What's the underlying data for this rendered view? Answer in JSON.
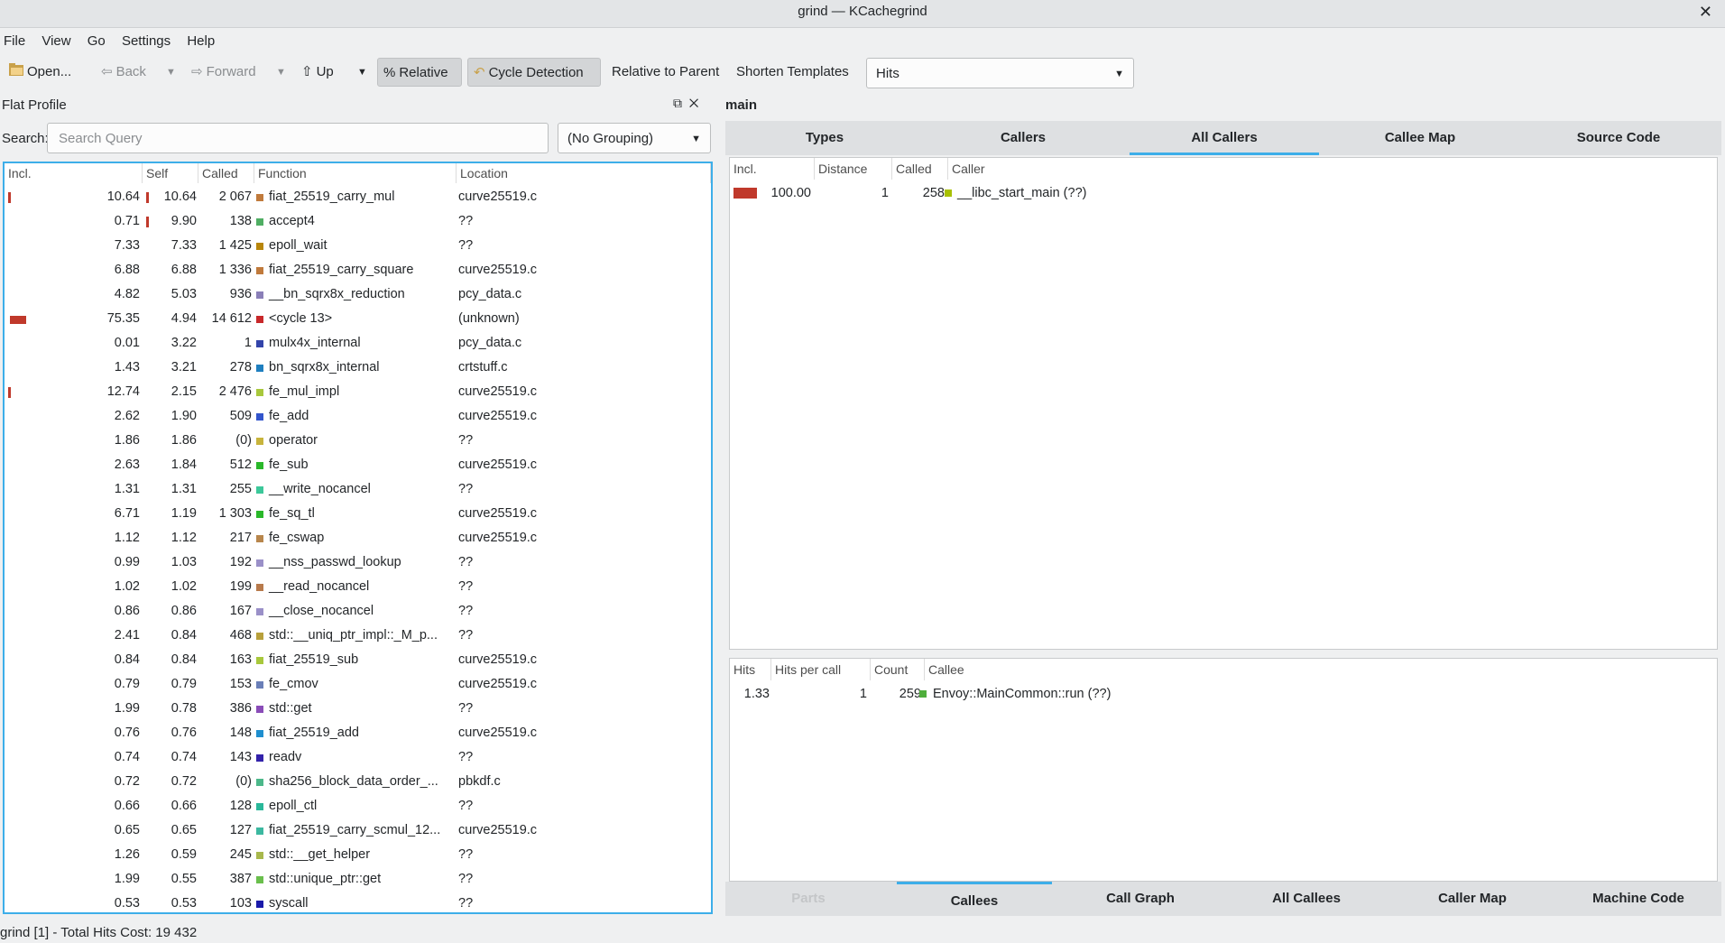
{
  "window": {
    "title": "grind — KCachegrind",
    "close_glyph": "✕"
  },
  "menu": [
    "File",
    "View",
    "Go",
    "Settings",
    "Help"
  ],
  "toolbar": {
    "open": "Open...",
    "back": "Back",
    "forward": "Forward",
    "up": "Up",
    "relative": "Relative",
    "cycle_detection": "Cycle Detection",
    "relative_to_parent": "Relative to Parent",
    "shorten_templates": "Shorten Templates",
    "event_type": "Hits"
  },
  "flat_profile": {
    "title": "Flat Profile",
    "search_label": "Search:",
    "search_placeholder": "Search Query",
    "grouping": "(No Grouping)",
    "columns": [
      "Incl.",
      "Self",
      "Called",
      "Function",
      "Location"
    ],
    "rows": [
      {
        "incl": "10.64",
        "self": "10.64",
        "called": "2 067",
        "func": "fiat_25519_carry_mul",
        "loc": "curve25519.c",
        "color": "#c07a3c",
        "incl_bar": "tick",
        "self_bar": "tick"
      },
      {
        "incl": "0.71",
        "self": "9.90",
        "called": "138",
        "func": "accept4",
        "loc": "??",
        "color": "#4fae63",
        "incl_bar": "",
        "self_bar": "tick"
      },
      {
        "incl": "7.33",
        "self": "7.33",
        "called": "1 425",
        "func": "epoll_wait",
        "loc": "??",
        "color": "#b8860b",
        "incl_bar": "",
        "self_bar": ""
      },
      {
        "incl": "6.88",
        "self": "6.88",
        "called": "1 336",
        "func": "fiat_25519_carry_square",
        "loc": "curve25519.c",
        "color": "#c07a3c",
        "incl_bar": "",
        "self_bar": ""
      },
      {
        "incl": "4.82",
        "self": "5.03",
        "called": "936",
        "func": "__bn_sqrx8x_reduction",
        "loc": "pcy_data.c",
        "color": "#8a7fb8",
        "incl_bar": "",
        "self_bar": ""
      },
      {
        "incl": "75.35",
        "self": "4.94",
        "called": "14 612",
        "func": "<cycle 13>",
        "loc": "(unknown)",
        "color": "#c8282a",
        "incl_bar": "wide",
        "self_bar": ""
      },
      {
        "incl": "0.01",
        "self": "3.22",
        "called": "1",
        "func": "mulx4x_internal",
        "loc": "pcy_data.c",
        "color": "#3344aa",
        "incl_bar": "",
        "self_bar": ""
      },
      {
        "incl": "1.43",
        "self": "3.21",
        "called": "278",
        "func": "bn_sqrx8x_internal",
        "loc": "crtstuff.c",
        "color": "#1f7fbf",
        "incl_bar": "",
        "self_bar": ""
      },
      {
        "incl": "12.74",
        "self": "2.15",
        "called": "2 476",
        "func": "fe_mul_impl",
        "loc": "curve25519.c",
        "color": "#a8c83c",
        "incl_bar": "tick",
        "self_bar": ""
      },
      {
        "incl": "2.62",
        "self": "1.90",
        "called": "509",
        "func": "fe_add",
        "loc": "curve25519.c",
        "color": "#3355cc",
        "incl_bar": "",
        "self_bar": ""
      },
      {
        "incl": "1.86",
        "self": "1.86",
        "called": "(0)",
        "func": "operator",
        "loc": "??",
        "color": "#c8b43c",
        "incl_bar": "",
        "self_bar": ""
      },
      {
        "incl": "2.63",
        "self": "1.84",
        "called": "512",
        "func": "fe_sub",
        "loc": "curve25519.c",
        "color": "#2ab82a",
        "incl_bar": "",
        "self_bar": ""
      },
      {
        "incl": "1.31",
        "self": "1.31",
        "called": "255",
        "func": "__write_nocancel",
        "loc": "??",
        "color": "#3cc89a",
        "incl_bar": "",
        "self_bar": ""
      },
      {
        "incl": "6.71",
        "self": "1.19",
        "called": "1 303",
        "func": "fe_sq_tl",
        "loc": "curve25519.c",
        "color": "#2ab82a",
        "incl_bar": "",
        "self_bar": ""
      },
      {
        "incl": "1.12",
        "self": "1.12",
        "called": "217",
        "func": "fe_cswap",
        "loc": "curve25519.c",
        "color": "#b8864c",
        "incl_bar": "",
        "self_bar": ""
      },
      {
        "incl": "0.99",
        "self": "1.03",
        "called": "192",
        "func": "__nss_passwd_lookup",
        "loc": "??",
        "color": "#9a90c8",
        "incl_bar": "",
        "self_bar": ""
      },
      {
        "incl": "1.02",
        "self": "1.02",
        "called": "199",
        "func": "__read_nocancel",
        "loc": "??",
        "color": "#b87a4c",
        "incl_bar": "",
        "self_bar": ""
      },
      {
        "incl": "0.86",
        "self": "0.86",
        "called": "167",
        "func": "__close_nocancel",
        "loc": "??",
        "color": "#9a90c8",
        "incl_bar": "",
        "self_bar": ""
      },
      {
        "incl": "2.41",
        "self": "0.84",
        "called": "468",
        "func": "std::__uniq_ptr_impl::_M_p...",
        "loc": "??",
        "color": "#b8a03c",
        "incl_bar": "",
        "self_bar": ""
      },
      {
        "incl": "0.84",
        "self": "0.84",
        "called": "163",
        "func": "fiat_25519_sub",
        "loc": "curve25519.c",
        "color": "#a8c83c",
        "incl_bar": "",
        "self_bar": ""
      },
      {
        "incl": "0.79",
        "self": "0.79",
        "called": "153",
        "func": "fe_cmov",
        "loc": "curve25519.c",
        "color": "#6a7fb8",
        "incl_bar": "",
        "self_bar": ""
      },
      {
        "incl": "1.99",
        "self": "0.78",
        "called": "386",
        "func": "std::get",
        "loc": "??",
        "color": "#8a4cb8",
        "incl_bar": "",
        "self_bar": ""
      },
      {
        "incl": "0.76",
        "self": "0.76",
        "called": "148",
        "func": "fiat_25519_add",
        "loc": "curve25519.c",
        "color": "#1f8fcf",
        "incl_bar": "",
        "self_bar": ""
      },
      {
        "incl": "0.74",
        "self": "0.74",
        "called": "143",
        "func": "readv",
        "loc": "??",
        "color": "#3322aa",
        "incl_bar": "",
        "self_bar": ""
      },
      {
        "incl": "0.72",
        "self": "0.72",
        "called": "(0)",
        "func": "sha256_block_data_order_...",
        "loc": "pbkdf.c",
        "color": "#4cb88a",
        "incl_bar": "",
        "self_bar": ""
      },
      {
        "incl": "0.66",
        "self": "0.66",
        "called": "128",
        "func": "epoll_ctl",
        "loc": "??",
        "color": "#2ab89a",
        "incl_bar": "",
        "self_bar": ""
      },
      {
        "incl": "0.65",
        "self": "0.65",
        "called": "127",
        "func": "fiat_25519_carry_scmul_12...",
        "loc": "curve25519.c",
        "color": "#3cb8a0",
        "incl_bar": "",
        "self_bar": ""
      },
      {
        "incl": "1.26",
        "self": "0.59",
        "called": "245",
        "func": "std::__get_helper",
        "loc": "??",
        "color": "#a8b84c",
        "incl_bar": "",
        "self_bar": ""
      },
      {
        "incl": "1.99",
        "self": "0.55",
        "called": "387",
        "func": "std::unique_ptr::get",
        "loc": "??",
        "color": "#6abf4c",
        "incl_bar": "",
        "self_bar": ""
      },
      {
        "incl": "0.53",
        "self": "0.53",
        "called": "103",
        "func": "syscall",
        "loc": "??",
        "color": "#1a1aaa",
        "incl_bar": "",
        "self_bar": ""
      }
    ]
  },
  "status": "grind [1] - Total Hits Cost: 19 432",
  "detail": {
    "title": "main",
    "top_tabs": [
      "Types",
      "Callers",
      "All Callers",
      "Callee Map",
      "Source Code"
    ],
    "top_selected": 2,
    "callers": {
      "columns": [
        "Incl.",
        "Distance",
        "Called",
        "Caller"
      ],
      "rows": [
        {
          "incl": "100.00",
          "distance": "1",
          "called": "258",
          "name": "__libc_start_main (??)",
          "color": "#a8c000"
        }
      ]
    },
    "callees": {
      "columns": [
        "Hits",
        "Hits per call",
        "Count",
        "Callee"
      ],
      "rows": [
        {
          "hits": "1.33",
          "per_call": "1",
          "count": "259",
          "name": "Envoy::MainCommon::run (??)",
          "color": "#4fae3c"
        }
      ]
    },
    "bottom_tabs": [
      "Parts",
      "Callees",
      "Call Graph",
      "All Callees",
      "Caller Map",
      "Machine Code"
    ],
    "bottom_selected": 1
  },
  "colors": {
    "accent": "#3daee9",
    "bar": "#c0392b"
  }
}
